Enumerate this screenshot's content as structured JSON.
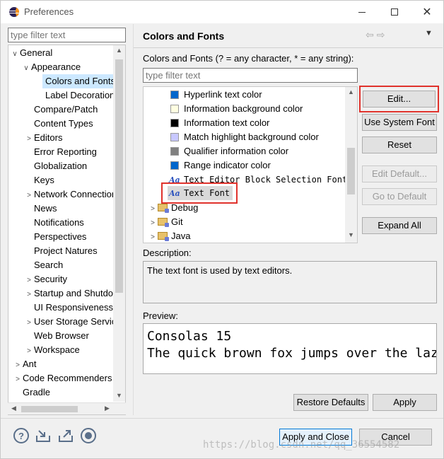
{
  "window": {
    "title": "Preferences"
  },
  "left": {
    "filter_placeholder": "type filter text",
    "tree": [
      {
        "label": "General",
        "arrow": "∨"
      },
      {
        "label": "Appearance",
        "arrow": "∨"
      },
      {
        "label": "Colors and Fonts",
        "arrow": ""
      },
      {
        "label": "Label Decorations",
        "arrow": ""
      },
      {
        "label": "Compare/Patch",
        "arrow": ""
      },
      {
        "label": "Content Types",
        "arrow": ""
      },
      {
        "label": "Editors",
        "arrow": ">"
      },
      {
        "label": "Error Reporting",
        "arrow": ""
      },
      {
        "label": "Globalization",
        "arrow": ""
      },
      {
        "label": "Keys",
        "arrow": ""
      },
      {
        "label": "Network Connections",
        "arrow": ">"
      },
      {
        "label": "News",
        "arrow": ""
      },
      {
        "label": "Notifications",
        "arrow": ""
      },
      {
        "label": "Perspectives",
        "arrow": ""
      },
      {
        "label": "Project Natures",
        "arrow": ""
      },
      {
        "label": "Search",
        "arrow": ""
      },
      {
        "label": "Security",
        "arrow": ">"
      },
      {
        "label": "Startup and Shutdown",
        "arrow": ">"
      },
      {
        "label": "UI Responsiveness",
        "arrow": ""
      },
      {
        "label": "User Storage Service",
        "arrow": ">"
      },
      {
        "label": "Web Browser",
        "arrow": ""
      },
      {
        "label": "Workspace",
        "arrow": ">"
      },
      {
        "label": "Ant",
        "arrow": ">"
      },
      {
        "label": "Code Recommenders",
        "arrow": ">"
      },
      {
        "label": "Gradle",
        "arrow": ""
      }
    ]
  },
  "right": {
    "page_title": "Colors and Fonts",
    "nav": {
      "back": "⇦",
      "forward": "⇨",
      "menu": "▼"
    },
    "colors_label": "Colors and Fonts (? = any character, * = any string):",
    "filter_placeholder": "type filter text",
    "items": [
      {
        "label": "Hyperlink text color",
        "kind": "color",
        "color": "#0066cc"
      },
      {
        "label": "Information background color",
        "kind": "color",
        "color": "#ffffe1"
      },
      {
        "label": "Information text color",
        "kind": "color",
        "color": "#000000"
      },
      {
        "label": "Match highlight background color",
        "kind": "color",
        "color": "#c8c8ff"
      },
      {
        "label": "Qualifier information color",
        "kind": "color",
        "color": "#808080"
      },
      {
        "label": "Range indicator color",
        "kind": "color",
        "color": "#0066cc"
      },
      {
        "label": "Text Editor Block Selection Font",
        "kind": "font",
        "icon": "Aa"
      },
      {
        "label": "Text Font",
        "kind": "font",
        "icon": "Aa"
      },
      {
        "label": "Debug",
        "kind": "folder"
      },
      {
        "label": "Git",
        "kind": "folder"
      },
      {
        "label": "Java",
        "kind": "folder"
      }
    ],
    "buttons": {
      "edit": "Edit...",
      "use_system_font": "Use System Font",
      "reset": "Reset",
      "edit_default": "Edit Default...",
      "go_to_default": "Go to Default",
      "expand_all": "Expand All"
    },
    "description_label": "Description:",
    "description_text": "The text font is used by text editors.",
    "preview_label": "Preview:",
    "preview_lines": [
      "Consolas 15",
      "The quick brown fox jumps over the lazy dog."
    ],
    "restore_defaults": "Restore Defaults",
    "apply": "Apply"
  },
  "bottom": {
    "apply_and_close": "Apply and Close",
    "cancel": "Cancel",
    "watermark": "https://blog.csdn.net/qq_36554582"
  },
  "colors": {
    "highlight": "#e0322c",
    "selection": "#cce8ff"
  }
}
